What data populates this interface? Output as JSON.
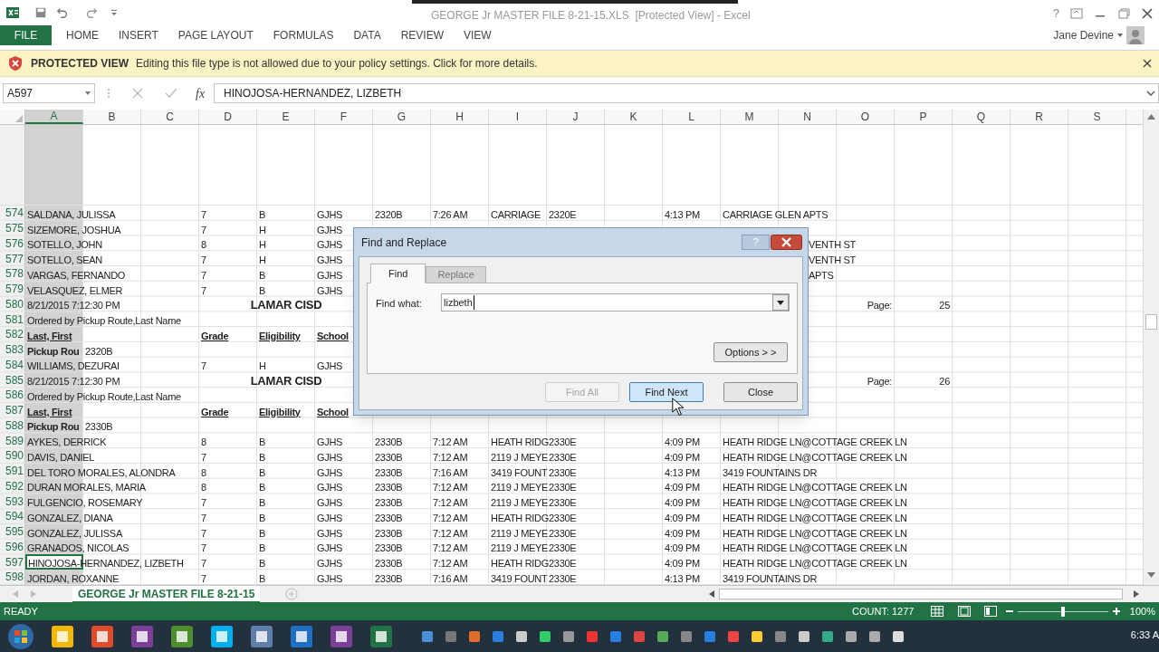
{
  "title_bar": {
    "title": "GEORGE Jr MASTER FILE 8-21-15.XLS  [Protected View] - Excel",
    "help": "?"
  },
  "ribbon_tabs": [
    {
      "label": "FILE",
      "kind": "file"
    },
    {
      "label": "HOME",
      "kind": "tab"
    },
    {
      "label": "INSERT",
      "kind": "tab"
    },
    {
      "label": "PAGE LAYOUT",
      "kind": "tab"
    },
    {
      "label": "FORMULAS",
      "kind": "tab"
    },
    {
      "label": "DATA",
      "kind": "tab"
    },
    {
      "label": "REVIEW",
      "kind": "tab"
    },
    {
      "label": "VIEW",
      "kind": "tab"
    }
  ],
  "account": {
    "name": "Jane Devine"
  },
  "message_bar": {
    "title": "PROTECTED VIEW",
    "message": "Editing this file type is not allowed due to your policy settings. Click for more details."
  },
  "formula_bar": {
    "name_box": "A597",
    "function_label": "fx",
    "content": "HINOJOSA-HERNANDEZ, LIZBETH"
  },
  "columns": [
    {
      "label": "A",
      "selected": true
    },
    {
      "label": "B",
      "selected": false
    },
    {
      "label": "C",
      "selected": false
    },
    {
      "label": "D",
      "selected": false
    },
    {
      "label": "E",
      "selected": false
    },
    {
      "label": "F",
      "selected": false
    },
    {
      "label": "G",
      "selected": false
    },
    {
      "label": "H",
      "selected": false
    },
    {
      "label": "I",
      "selected": false
    },
    {
      "label": "J",
      "selected": false
    },
    {
      "label": "K",
      "selected": false
    },
    {
      "label": "L",
      "selected": false
    },
    {
      "label": "M",
      "selected": false
    },
    {
      "label": "N",
      "selected": false
    },
    {
      "label": "O",
      "selected": false
    },
    {
      "label": "P",
      "selected": false
    },
    {
      "label": "Q",
      "selected": false
    },
    {
      "label": "R",
      "selected": false
    },
    {
      "label": "S",
      "selected": false
    }
  ],
  "rows": [
    {
      "number": "574",
      "cells": {
        "A": {
          "kind": "plain",
          "active": false,
          "text": "SALDANA, JULISSA"
        },
        "D": {
          "kind": "plain",
          "text": "7"
        },
        "E": {
          "kind": "plain",
          "text": "B"
        },
        "F": {
          "kind": "plain",
          "text": "GJHS"
        },
        "G": {
          "kind": "plain",
          "text": "2320B"
        },
        "H": {
          "kind": "plain",
          "text": "7:26 AM"
        },
        "I": {
          "kind": "plain",
          "text": "CARRIAGE"
        },
        "J": {
          "kind": "plain",
          "text": "2320E"
        },
        "L": {
          "kind": "plain",
          "text": "4:13 PM"
        },
        "M": {
          "kind": "plain",
          "text": "CARRIAGE GLEN APTS"
        }
      }
    },
    {
      "number": "575",
      "cells": {
        "A": {
          "kind": "plain",
          "active": false,
          "text": "SIZEMORE, JOSHUA"
        },
        "D": {
          "kind": "plain",
          "text": "7"
        },
        "E": {
          "kind": "plain",
          "text": "H"
        },
        "F": {
          "kind": "plain",
          "text": "GJHS"
        }
      }
    },
    {
      "number": "576",
      "cells": {
        "A": {
          "kind": "plain",
          "active": false,
          "text": "SOTELLO, JOHN"
        },
        "D": {
          "kind": "plain",
          "text": "8"
        },
        "E": {
          "kind": "plain",
          "text": "H"
        },
        "F": {
          "kind": "plain",
          "text": "GJHS"
        },
        "N": {
          "kind": "clipped",
          "text": "VENTH ST"
        }
      }
    },
    {
      "number": "577",
      "cells": {
        "A": {
          "kind": "plain",
          "active": false,
          "text": "SOTELLO, SEAN"
        },
        "D": {
          "kind": "plain",
          "text": "7"
        },
        "E": {
          "kind": "plain",
          "text": "H"
        },
        "F": {
          "kind": "plain",
          "text": "GJHS"
        },
        "N": {
          "kind": "clipped",
          "text": "VENTH ST"
        }
      }
    },
    {
      "number": "578",
      "cells": {
        "A": {
          "kind": "plain",
          "active": false,
          "text": "VARGAS, FERNANDO"
        },
        "D": {
          "kind": "plain",
          "text": "7"
        },
        "E": {
          "kind": "plain",
          "text": "B"
        },
        "F": {
          "kind": "plain",
          "text": "GJHS"
        },
        "N": {
          "kind": "clipped",
          "text": "APTS"
        }
      }
    },
    {
      "number": "579",
      "cells": {
        "A": {
          "kind": "plain",
          "active": false,
          "text": "VELASQUEZ, ELMER"
        },
        "D": {
          "kind": "plain",
          "text": "7"
        },
        "E": {
          "kind": "plain",
          "text": "B"
        },
        "F": {
          "kind": "plain",
          "text": "GJHS"
        }
      }
    },
    {
      "number": "580",
      "cells": {
        "A": {
          "kind": "plain",
          "active": false,
          "text": "8/21/2015 7:12:30 PM"
        },
        "E": {
          "kind": "title",
          "text": "LAMAR CISD"
        },
        "O": {
          "kind": "right",
          "text": "Page:"
        },
        "P": {
          "kind": "right",
          "text": "25"
        }
      }
    },
    {
      "number": "581",
      "cells": {
        "A": {
          "kind": "plain",
          "active": false,
          "text": "Ordered by Pickup Route,Last Name"
        }
      }
    },
    {
      "number": "582",
      "cells": {
        "A": {
          "kind": "heading",
          "active": false,
          "text": "Last, First"
        },
        "D": {
          "kind": "heading",
          "text": "Grade"
        },
        "E": {
          "kind": "heading",
          "text": "Eligibility"
        },
        "F": {
          "kind": "heading",
          "text": "School"
        }
      }
    },
    {
      "number": "583",
      "cells": {
        "A": {
          "kind": "bold",
          "active": false,
          "text": "Pickup Rou"
        },
        "B": {
          "kind": "plain",
          "text": "2320B"
        }
      }
    },
    {
      "number": "584",
      "cells": {
        "A": {
          "kind": "plain",
          "active": false,
          "text": "WILLIAMS, DEZURAI"
        },
        "D": {
          "kind": "plain",
          "text": "7"
        },
        "E": {
          "kind": "plain",
          "text": "H"
        },
        "F": {
          "kind": "plain",
          "text": "GJHS"
        }
      }
    },
    {
      "number": "585",
      "cells": {
        "A": {
          "kind": "plain",
          "active": false,
          "text": "8/21/2015 7:12:30 PM"
        },
        "E": {
          "kind": "title",
          "text": "LAMAR CISD"
        },
        "O": {
          "kind": "right",
          "text": "Page:"
        },
        "P": {
          "kind": "right",
          "text": "26"
        }
      }
    },
    {
      "number": "586",
      "cells": {
        "A": {
          "kind": "plain",
          "active": false,
          "text": "Ordered by Pickup Route,Last Name"
        }
      }
    },
    {
      "number": "587",
      "cells": {
        "A": {
          "kind": "heading",
          "active": false,
          "text": "Last, First"
        },
        "D": {
          "kind": "heading",
          "text": "Grade"
        },
        "E": {
          "kind": "heading",
          "text": "Eligibility"
        },
        "F": {
          "kind": "heading",
          "text": "School"
        }
      }
    },
    {
      "number": "588",
      "cells": {
        "A": {
          "kind": "bold",
          "active": false,
          "text": "Pickup Rou"
        },
        "B": {
          "kind": "plain",
          "text": "2330B"
        }
      }
    },
    {
      "number": "589",
      "cells": {
        "A": {
          "kind": "plain",
          "active": false,
          "text": "AYKES, DERRICK"
        },
        "D": {
          "kind": "plain",
          "text": "8"
        },
        "E": {
          "kind": "plain",
          "text": "B"
        },
        "F": {
          "kind": "plain",
          "text": "GJHS"
        },
        "G": {
          "kind": "plain",
          "text": "2330B"
        },
        "H": {
          "kind": "plain",
          "text": "7:12 AM"
        },
        "I": {
          "kind": "plain",
          "text": "HEATH RIDG"
        },
        "J": {
          "kind": "plain",
          "text": "2330E"
        },
        "L": {
          "kind": "plain",
          "text": "4:09 PM"
        },
        "M": {
          "kind": "plain",
          "text": "HEATH RIDGE LN@COTTAGE CREEK LN"
        }
      }
    },
    {
      "number": "590",
      "cells": {
        "A": {
          "kind": "plain",
          "active": false,
          "text": "DAVIS, DANIEL"
        },
        "D": {
          "kind": "plain",
          "text": "7"
        },
        "E": {
          "kind": "plain",
          "text": "B"
        },
        "F": {
          "kind": "plain",
          "text": "GJHS"
        },
        "G": {
          "kind": "plain",
          "text": "2330B"
        },
        "H": {
          "kind": "plain",
          "text": "7:12 AM"
        },
        "I": {
          "kind": "plain",
          "text": "2119 J MEYE"
        },
        "J": {
          "kind": "plain",
          "text": "2330E"
        },
        "L": {
          "kind": "plain",
          "text": "4:09 PM"
        },
        "M": {
          "kind": "plain",
          "text": "HEATH RIDGE LN@COTTAGE CREEK LN"
        }
      }
    },
    {
      "number": "591",
      "cells": {
        "A": {
          "kind": "plain",
          "active": false,
          "text": "DEL TORO MORALES, ALONDRA"
        },
        "D": {
          "kind": "plain",
          "text": "8"
        },
        "E": {
          "kind": "plain",
          "text": "B"
        },
        "F": {
          "kind": "plain",
          "text": "GJHS"
        },
        "G": {
          "kind": "plain",
          "text": "2330B"
        },
        "H": {
          "kind": "plain",
          "text": "7:16 AM"
        },
        "I": {
          "kind": "plain",
          "text": "3419 FOUNT"
        },
        "J": {
          "kind": "plain",
          "text": "2330E"
        },
        "L": {
          "kind": "plain",
          "text": "4:13 PM"
        },
        "M": {
          "kind": "plain",
          "text": "3419 FOUNTAINS DR"
        }
      }
    },
    {
      "number": "592",
      "cells": {
        "A": {
          "kind": "plain",
          "active": false,
          "text": "DURAN MORALES, MARIA"
        },
        "D": {
          "kind": "plain",
          "text": "8"
        },
        "E": {
          "kind": "plain",
          "text": "B"
        },
        "F": {
          "kind": "plain",
          "text": "GJHS"
        },
        "G": {
          "kind": "plain",
          "text": "2330B"
        },
        "H": {
          "kind": "plain",
          "text": "7:12 AM"
        },
        "I": {
          "kind": "plain",
          "text": "2119 J MEYE"
        },
        "J": {
          "kind": "plain",
          "text": "2330E"
        },
        "L": {
          "kind": "plain",
          "text": "4:09 PM"
        },
        "M": {
          "kind": "plain",
          "text": "HEATH RIDGE LN@COTTAGE CREEK LN"
        }
      }
    },
    {
      "number": "593",
      "cells": {
        "A": {
          "kind": "plain",
          "active": false,
          "text": "FULGENCIO, ROSEMARY"
        },
        "D": {
          "kind": "plain",
          "text": "7"
        },
        "E": {
          "kind": "plain",
          "text": "B"
        },
        "F": {
          "kind": "plain",
          "text": "GJHS"
        },
        "G": {
          "kind": "plain",
          "text": "2330B"
        },
        "H": {
          "kind": "plain",
          "text": "7:12 AM"
        },
        "I": {
          "kind": "plain",
          "text": "2119 J MEYE"
        },
        "J": {
          "kind": "plain",
          "text": "2330E"
        },
        "L": {
          "kind": "plain",
          "text": "4:09 PM"
        },
        "M": {
          "kind": "plain",
          "text": "HEATH RIDGE LN@COTTAGE CREEK LN"
        }
      }
    },
    {
      "number": "594",
      "cells": {
        "A": {
          "kind": "plain",
          "active": false,
          "text": "GONZALEZ, DIANA"
        },
        "D": {
          "kind": "plain",
          "text": "7"
        },
        "E": {
          "kind": "plain",
          "text": "B"
        },
        "F": {
          "kind": "plain",
          "text": "GJHS"
        },
        "G": {
          "kind": "plain",
          "text": "2330B"
        },
        "H": {
          "kind": "plain",
          "text": "7:12 AM"
        },
        "I": {
          "kind": "plain",
          "text": "HEATH RIDG"
        },
        "J": {
          "kind": "plain",
          "text": "2330E"
        },
        "L": {
          "kind": "plain",
          "text": "4:09 PM"
        },
        "M": {
          "kind": "plain",
          "text": "HEATH RIDGE LN@COTTAGE CREEK LN"
        }
      }
    },
    {
      "number": "595",
      "cells": {
        "A": {
          "kind": "plain",
          "active": false,
          "text": "GONZALEZ, JULISSA"
        },
        "D": {
          "kind": "plain",
          "text": "7"
        },
        "E": {
          "kind": "plain",
          "text": "B"
        },
        "F": {
          "kind": "plain",
          "text": "GJHS"
        },
        "G": {
          "kind": "plain",
          "text": "2330B"
        },
        "H": {
          "kind": "plain",
          "text": "7:12 AM"
        },
        "I": {
          "kind": "plain",
          "text": "2119 J MEYE"
        },
        "J": {
          "kind": "plain",
          "text": "2330E"
        },
        "L": {
          "kind": "plain",
          "text": "4:09 PM"
        },
        "M": {
          "kind": "plain",
          "text": "HEATH RIDGE LN@COTTAGE CREEK LN"
        }
      }
    },
    {
      "number": "596",
      "cells": {
        "A": {
          "kind": "plain",
          "active": false,
          "text": "GRANADOS, NICOLAS"
        },
        "D": {
          "kind": "plain",
          "text": "7"
        },
        "E": {
          "kind": "plain",
          "text": "B"
        },
        "F": {
          "kind": "plain",
          "text": "GJHS"
        },
        "G": {
          "kind": "plain",
          "text": "2330B"
        },
        "H": {
          "kind": "plain",
          "text": "7:12 AM"
        },
        "I": {
          "kind": "plain",
          "text": "2119 J MEYE"
        },
        "J": {
          "kind": "plain",
          "text": "2330E"
        },
        "L": {
          "kind": "plain",
          "text": "4:09 PM"
        },
        "M": {
          "kind": "plain",
          "text": "HEATH RIDGE LN@COTTAGE CREEK LN"
        }
      }
    },
    {
      "number": "597",
      "cells": {
        "A": {
          "kind": "plain",
          "active": true,
          "text": "HINOJOSA-HERNANDEZ, LIZBETH"
        },
        "D": {
          "kind": "plain",
          "text": "7"
        },
        "E": {
          "kind": "plain",
          "text": "B"
        },
        "F": {
          "kind": "plain",
          "text": "GJHS"
        },
        "G": {
          "kind": "plain",
          "text": "2330B"
        },
        "H": {
          "kind": "plain",
          "text": "7:12 AM"
        },
        "I": {
          "kind": "plain",
          "text": "HEATH RIDG"
        },
        "J": {
          "kind": "plain",
          "text": "2330E"
        },
        "L": {
          "kind": "plain",
          "text": "4:09 PM"
        },
        "M": {
          "kind": "plain",
          "text": "HEATH RIDGE LN@COTTAGE CREEK LN"
        }
      }
    },
    {
      "number": "598",
      "cells": {
        "A": {
          "kind": "plain",
          "active": false,
          "text": "JORDAN, ROXANNE"
        },
        "D": {
          "kind": "plain",
          "text": "7"
        },
        "E": {
          "kind": "plain",
          "text": "B"
        },
        "F": {
          "kind": "plain",
          "text": "GJHS"
        },
        "G": {
          "kind": "plain",
          "text": "2330B"
        },
        "H": {
          "kind": "plain",
          "text": "7:16 AM"
        },
        "I": {
          "kind": "plain",
          "text": "3419 FOUNT"
        },
        "J": {
          "kind": "plain",
          "text": "2330E"
        },
        "L": {
          "kind": "plain",
          "text": "4:13 PM"
        },
        "M": {
          "kind": "plain",
          "text": "3419 FOUNTAINS DR"
        }
      }
    }
  ],
  "dialog": {
    "title": "Find and Replace",
    "help": "?",
    "tabs": [
      {
        "label": "Find",
        "selected": true
      },
      {
        "label": "Replace",
        "selected": false
      }
    ],
    "find_label": "Find what:",
    "find_value": "lizbeth",
    "buttons": [
      {
        "label": "Options > >",
        "kind": "options",
        "disabled": false
      },
      {
        "label": "Find All",
        "kind": "action",
        "disabled": true
      },
      {
        "label": "Find Next",
        "kind": "default",
        "disabled": false
      },
      {
        "label": "Close",
        "kind": "action",
        "disabled": false
      }
    ]
  },
  "sheet_tabs": [
    {
      "label": "GEORGE Jr MASTER FILE 8-21-15",
      "selected": true
    }
  ],
  "status_bar": {
    "mode": "READY",
    "count": "COUNT: 1277",
    "zoom": "100%",
    "zoom_level": {
      "level": 0.5
    }
  },
  "taskbar": {
    "clock": "6:33 A"
  }
}
